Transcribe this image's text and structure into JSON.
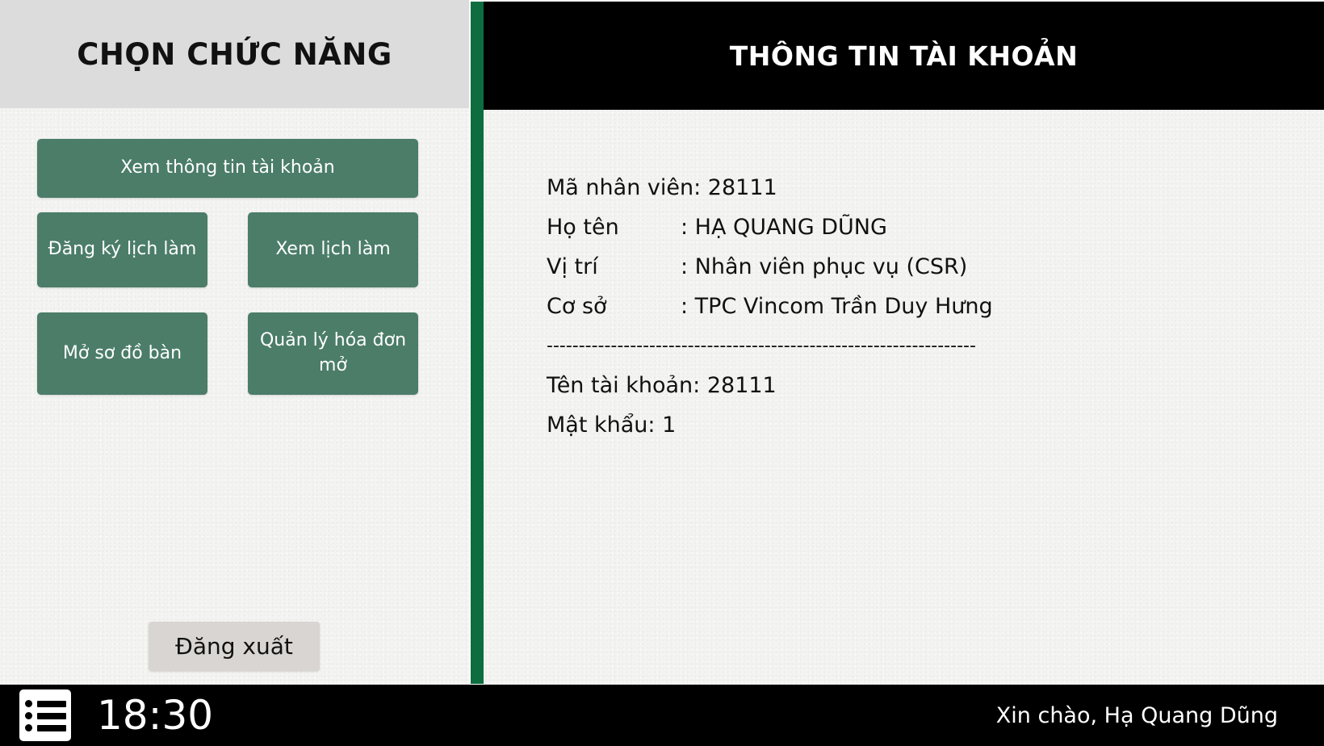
{
  "left_panel": {
    "title": "CHỌN CHỨC NĂNG",
    "buttons": {
      "account": "Xem thông tin tài khoản",
      "register_schedule": "Đăng ký lịch làm",
      "view_schedule": "Xem lịch làm",
      "table_map": "Mở sơ đồ bàn",
      "manage_invoices": "Quản lý hóa đơn mở"
    },
    "logout": "Đăng xuất"
  },
  "right_panel": {
    "title": "THÔNG TIN TÀI KHOẢN",
    "employee_id": {
      "label": "Mã nhân viên:",
      "value": "28111"
    },
    "full_name": {
      "label": "Họ tên",
      "value": ": HẠ QUANG DŨNG"
    },
    "position": {
      "label": "Vị trí",
      "value": ": Nhân viên phục vụ (CSR)"
    },
    "branch": {
      "label": "Cơ sở",
      "value": ": TPC Vincom Trần Duy Hưng"
    },
    "separator": "-------------------------------------------------------------------",
    "username": {
      "label": "Tên tài khoản:",
      "value": "28111"
    },
    "password": {
      "label": "Mật khẩu:",
      "value": "1"
    }
  },
  "bottom_bar": {
    "menu_icon": "list-menu-icon",
    "time": "18:30",
    "greeting": "Xin chào, Hạ Quang Dũng"
  },
  "colors": {
    "button_green": "#4b7d69",
    "divider_green": "#0d6d3f",
    "left_header_bg": "#dcdcdc",
    "bar_black": "#000000",
    "logout_bg": "#d9d5d2"
  }
}
